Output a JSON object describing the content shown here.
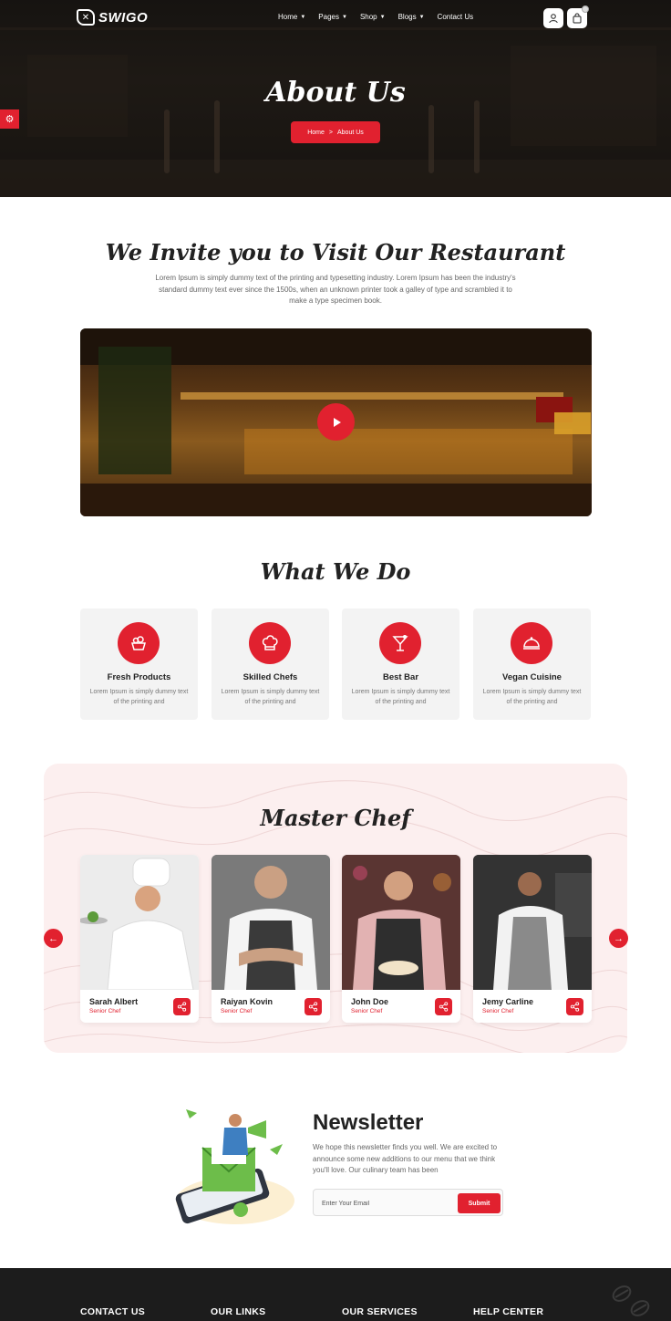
{
  "colors": {
    "accent": "#e1212f",
    "dark": "#1c1c1c",
    "light_card": "#f3f3f3"
  },
  "header": {
    "logo_text": "SWIGO",
    "nav": [
      {
        "label": "Home",
        "has_dropdown": true
      },
      {
        "label": "Pages",
        "has_dropdown": true
      },
      {
        "label": "Shop",
        "has_dropdown": true
      },
      {
        "label": "Blogs",
        "has_dropdown": true
      },
      {
        "label": "Contact Us",
        "has_dropdown": false
      }
    ],
    "icons": [
      "user-icon",
      "shopping-bag-icon",
      "settings-gear-icon"
    ]
  },
  "hero": {
    "title": "About Us",
    "breadcrumb": {
      "home": "Home",
      "separator": ">",
      "current": "About Us"
    }
  },
  "invite": {
    "title": "We Invite you to Visit Our Restaurant",
    "text": "Lorem Ipsum is simply dummy text of the printing and typesetting industry. Lorem Ipsum has been the industry's standard dummy text ever since the 1500s, when an unknown printer took a galley of type and scrambled it to make a type specimen book."
  },
  "what_we_do": {
    "title": "What We Do",
    "items": [
      {
        "title": "Fresh Products",
        "text": "Lorem Ipsum is simply dummy text of the printing and",
        "icon": "fresh-products-icon"
      },
      {
        "title": "Skilled Chefs",
        "text": "Lorem Ipsum is simply dummy text of the printing and",
        "icon": "chef-hat-icon"
      },
      {
        "title": "Best Bar",
        "text": "Lorem Ipsum is simply dummy text of the printing and",
        "icon": "cocktail-icon"
      },
      {
        "title": "Vegan Cuisine",
        "text": "Lorem Ipsum is simply dummy text of the printing and",
        "icon": "cloche-icon"
      }
    ]
  },
  "master_chef": {
    "title": "Master Chef",
    "chefs": [
      {
        "name": "Sarah Albert",
        "role": "Senior Chef"
      },
      {
        "name": "Raiyan Kovin",
        "role": "Senior Chef"
      },
      {
        "name": "John Doe",
        "role": "Senior Chef"
      },
      {
        "name": "Jemy Carline",
        "role": "Senior Chef"
      }
    ]
  },
  "newsletter": {
    "title": "Newsletter",
    "text": "We hope this newsletter finds you well. We are excited to announce some new additions to our menu that we think you'll love. Our culinary team has been",
    "placeholder": "Enter Your Email",
    "button": "Submit"
  },
  "footer": {
    "headings": [
      "CONTACT US",
      "OUR LINKS",
      "OUR SERVICES",
      "HELP CENTER"
    ]
  }
}
